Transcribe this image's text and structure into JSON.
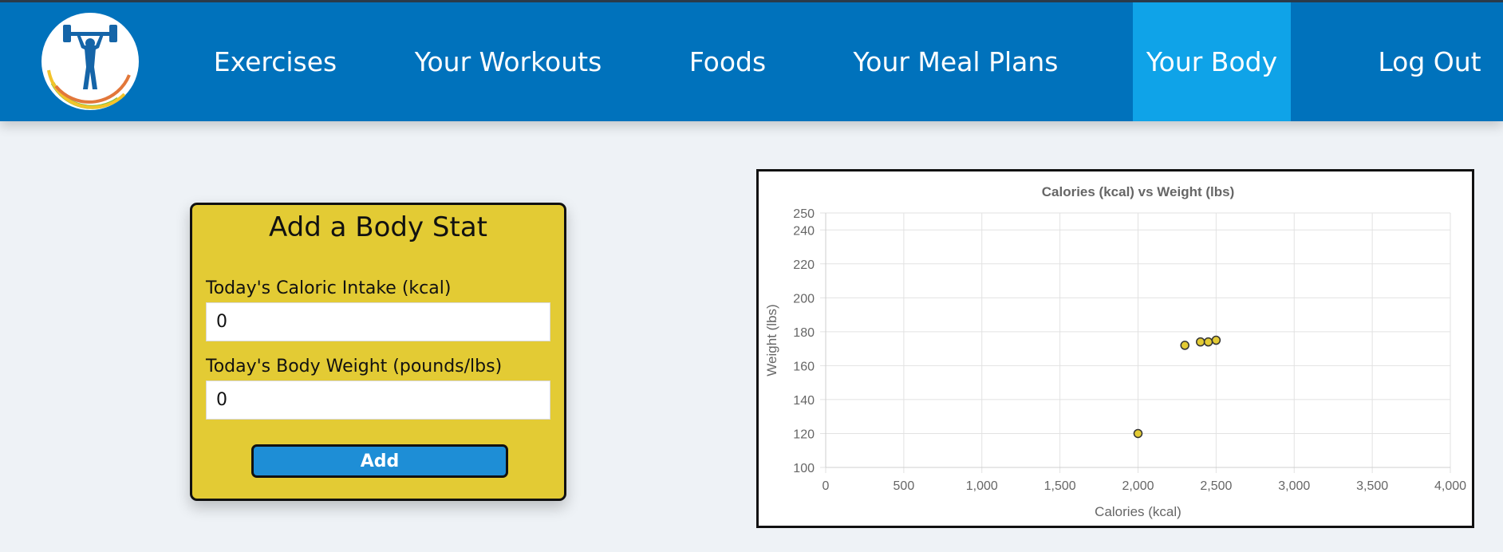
{
  "nav": {
    "logo": "weightlifter-logo-icon",
    "items": [
      {
        "label": "Exercises",
        "active": false
      },
      {
        "label": "Your Workouts",
        "active": false
      },
      {
        "label": "Foods",
        "active": false
      },
      {
        "label": "Your Meal Plans",
        "active": false
      },
      {
        "label": "Your Body",
        "active": true
      },
      {
        "label": "Log Out",
        "active": false
      }
    ]
  },
  "form": {
    "title": "Add a Body Stat",
    "calories_label": "Today's Caloric Intake (kcal)",
    "calories_value": "0",
    "weight_label": "Today's Body Weight (pounds/lbs)",
    "weight_value": "0",
    "add_label": "Add"
  },
  "colors": {
    "nav_bg": "#0072bc",
    "nav_active": "#0fa3e8",
    "card_bg": "#e3cb34",
    "button_bg": "#1e8ed6",
    "point_fill": "#e3cb34"
  },
  "chart_data": {
    "type": "scatter",
    "title": "Calories (kcal) vs Weight (lbs)",
    "xlabel": "Calories (kcal)",
    "ylabel": "Weight (lbs)",
    "xlim": [
      0,
      4000
    ],
    "ylim": [
      100,
      250
    ],
    "x_ticks": [
      0,
      500,
      1000,
      1500,
      2000,
      2500,
      3000,
      3500,
      4000
    ],
    "x_tick_labels": [
      "0",
      "500",
      "1,000",
      "1,500",
      "2,000",
      "2,500",
      "3,000",
      "3,500",
      "4,000"
    ],
    "y_ticks": [
      100,
      120,
      140,
      160,
      180,
      200,
      220,
      240,
      250
    ],
    "y_tick_labels": [
      "100",
      "120",
      "140",
      "160",
      "180",
      "200",
      "220",
      "240",
      "250"
    ],
    "grid": true,
    "legend": "none",
    "points": [
      {
        "x": 2000,
        "y": 120
      },
      {
        "x": 2300,
        "y": 172
      },
      {
        "x": 2400,
        "y": 174
      },
      {
        "x": 2450,
        "y": 174
      },
      {
        "x": 2500,
        "y": 175
      }
    ]
  }
}
